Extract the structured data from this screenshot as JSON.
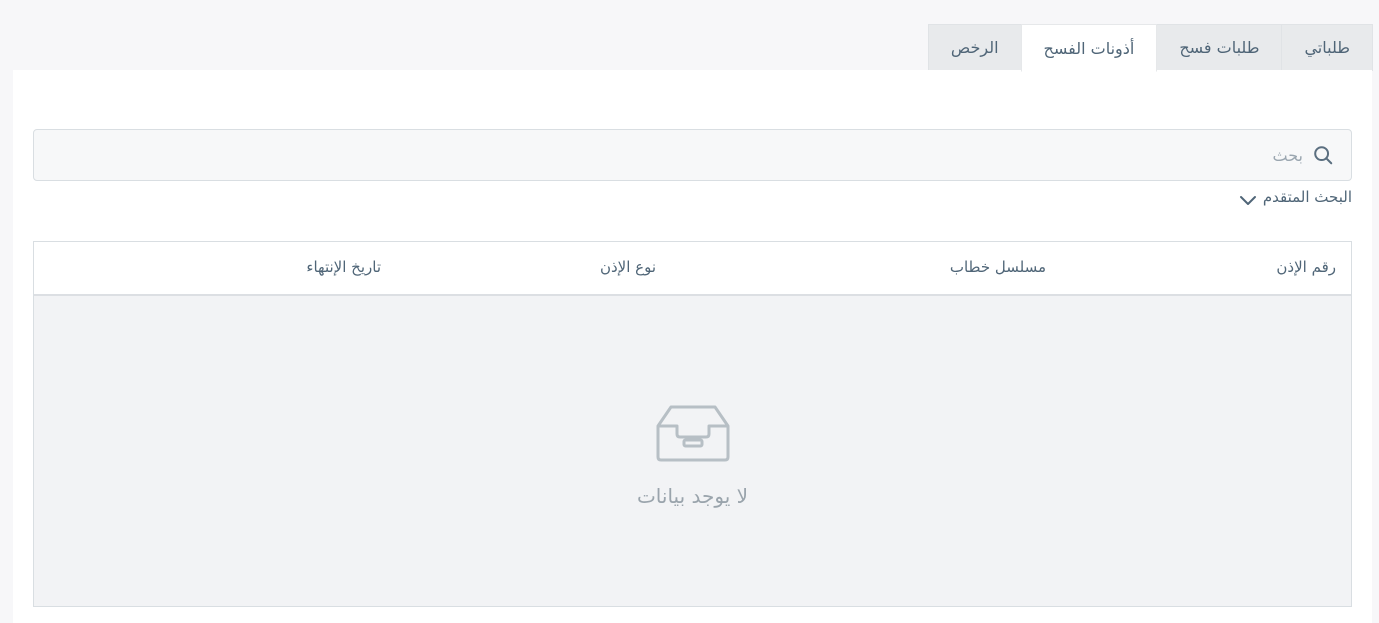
{
  "tabs": [
    {
      "label": "طلباتي",
      "active": false
    },
    {
      "label": "طلبات فسح",
      "active": false
    },
    {
      "label": "أذونات الفسح",
      "active": true
    },
    {
      "label": "الرخص",
      "active": false
    }
  ],
  "search": {
    "placeholder": "بحث",
    "value": "",
    "icon": "search-icon"
  },
  "advanced_search": {
    "label": "البحث المتقدم",
    "icon": "chevron-down-icon"
  },
  "table": {
    "columns": [
      "رقم الإذن",
      "مسلسل خطاب",
      "نوع الإذن",
      "تاريخ الإنتهاء"
    ],
    "rows": [],
    "empty_text": "لا يوجد بيانات",
    "empty_icon": "inbox-icon"
  },
  "colors": {
    "text": "#4f6577",
    "tab_inactive_bg": "#e8eaec",
    "empty_bg": "#f2f3f5",
    "border": "#d9dee2"
  }
}
